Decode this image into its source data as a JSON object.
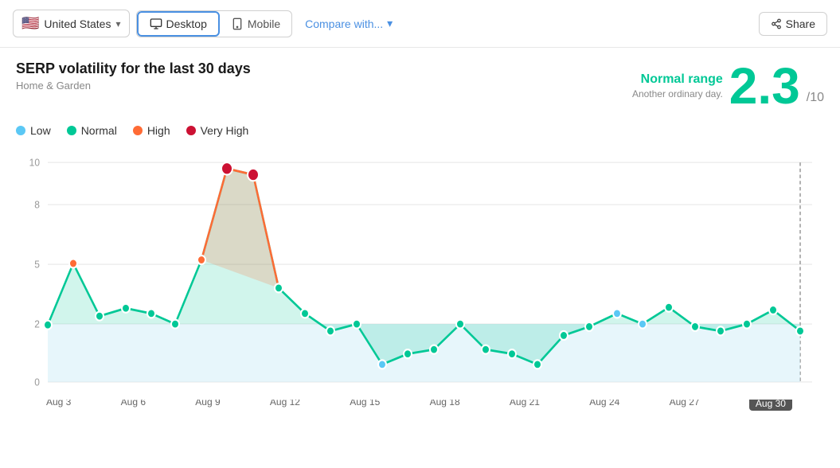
{
  "topbar": {
    "country": "United States",
    "flag": "🇺🇸",
    "devices": [
      "Desktop",
      "Mobile"
    ],
    "active_device": "Desktop",
    "compare_label": "Compare with...",
    "share_label": "Share"
  },
  "header": {
    "title": "SERP volatility for the last 30 days",
    "subtitle": "Home & Garden",
    "score_label": "Normal range",
    "score_desc": "Another ordinary day.",
    "score_value": "2.3",
    "score_denom": "/10"
  },
  "legend": [
    {
      "label": "Low",
      "color": "#5bc8f5"
    },
    {
      "label": "Normal",
      "color": "#00c896"
    },
    {
      "label": "High",
      "color": "#ff6b35"
    },
    {
      "label": "Very High",
      "color": "#cc1133"
    }
  ],
  "x_labels": [
    "Aug 3",
    "Aug 6",
    "Aug 9",
    "Aug 12",
    "Aug 15",
    "Aug 18",
    "Aug 21",
    "Aug 24",
    "Aug 27",
    "Aug 30"
  ],
  "x_label_active": "Aug 30",
  "y_labels": [
    "0",
    "2",
    "5",
    "8",
    "10"
  ],
  "colors": {
    "accent_green": "#00c896",
    "accent_blue": "#5bc8f5",
    "accent_orange": "#ff6b35",
    "accent_red": "#cc1133"
  }
}
